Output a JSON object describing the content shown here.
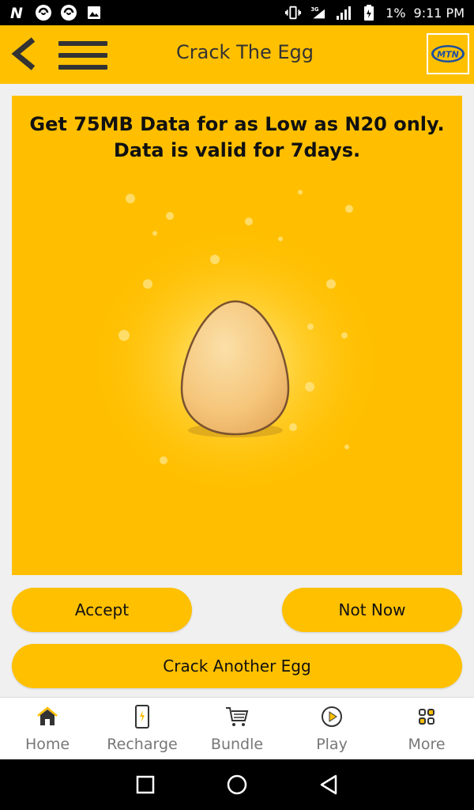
{
  "status_bar": {
    "network_type": "3G",
    "battery": "1%",
    "time": "9:11 PM"
  },
  "app_bar": {
    "title": "Crack The Egg",
    "logo_text": "MTN"
  },
  "offer": {
    "line1": "Get 75MB Data for as Low as N20 only.",
    "line2": "Data is valid for 7days."
  },
  "buttons": {
    "accept": "Accept",
    "not_now": "Not Now",
    "crack_another": "Crack Another Egg"
  },
  "bottom_nav": {
    "items": [
      {
        "label": "Home",
        "icon": "home-icon"
      },
      {
        "label": "Recharge",
        "icon": "phone-icon"
      },
      {
        "label": "Bundle",
        "icon": "cart-icon"
      },
      {
        "label": "Play",
        "icon": "play-icon"
      },
      {
        "label": "More",
        "icon": "grid-icon"
      }
    ]
  },
  "colors": {
    "brand_yellow": "#ffc000",
    "card_yellow": "#ffbf00",
    "egg_fill": "#f7cf8a",
    "egg_outline": "#7a5230"
  }
}
